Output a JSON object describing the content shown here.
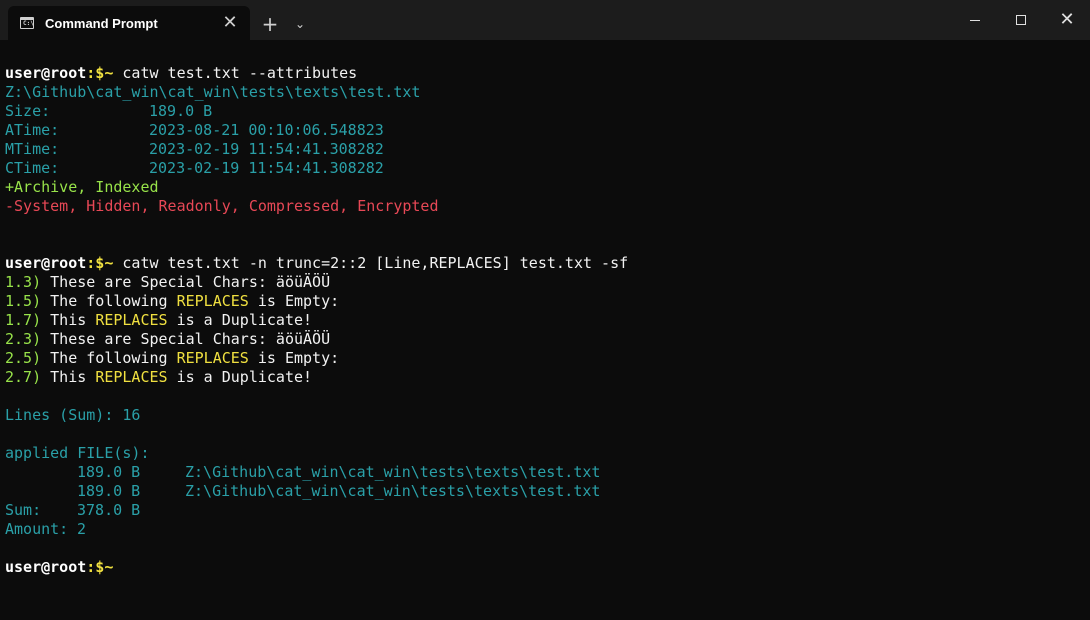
{
  "window": {
    "tab_title": "Command Prompt",
    "tab_close": "✕",
    "new_tab": "+",
    "dropdown": "⌄",
    "close": "✕"
  },
  "prompt": {
    "user": "user@root",
    "sep": ":$~"
  },
  "commands": {
    "cmd1": " catw test.txt --attributes",
    "cmd2": " catw test.txt -n trunc=2::2 [Line,REPLACES] test.txt -sf"
  },
  "attributes": {
    "path": "Z:\\Github\\cat_win\\cat_win\\tests\\texts\\test.txt",
    "size_label": "Size:",
    "size_value": "189.0 B",
    "atime_label": "ATime:",
    "atime_value": "2023-08-21 00:10:06.548823",
    "mtime_label": "MTime:",
    "mtime_value": "2023-02-19 11:54:41.308282",
    "ctime_label": "CTime:",
    "ctime_value": "2023-02-19 11:54:41.308282",
    "set_flags": "+Archive, Indexed",
    "unset_flags": "-System, Hidden, Readonly, Compressed, Encrypted"
  },
  "output_lines": [
    {
      "num": "1.3)",
      "pre": " These are Special Chars: äöüÄÖÜ",
      "hl": "",
      "post": ""
    },
    {
      "num": "1.5)",
      "pre": " The following ",
      "hl": "REPLACES",
      "post": " is Empty:"
    },
    {
      "num": "1.7)",
      "pre": " This ",
      "hl": "REPLACES",
      "post": " is a Duplicate!"
    },
    {
      "num": "2.3)",
      "pre": " These are Special Chars: äöüÄÖÜ",
      "hl": "",
      "post": ""
    },
    {
      "num": "2.5)",
      "pre": " The following ",
      "hl": "REPLACES",
      "post": " is Empty:"
    },
    {
      "num": "2.7)",
      "pre": " This ",
      "hl": "REPLACES",
      "post": " is a Duplicate!"
    }
  ],
  "summary": {
    "lines_sum": "Lines (Sum): 16",
    "applied": "applied FILE(s):",
    "files": [
      {
        "size": "189.0 B",
        "path": "Z:\\Github\\cat_win\\cat_win\\tests\\texts\\test.txt"
      },
      {
        "size": "189.0 B",
        "path": "Z:\\Github\\cat_win\\cat_win\\tests\\texts\\test.txt"
      }
    ],
    "sum_label": "Sum:",
    "sum_value": "378.0 B",
    "amount_label": "Amount:",
    "amount_value": "2"
  }
}
